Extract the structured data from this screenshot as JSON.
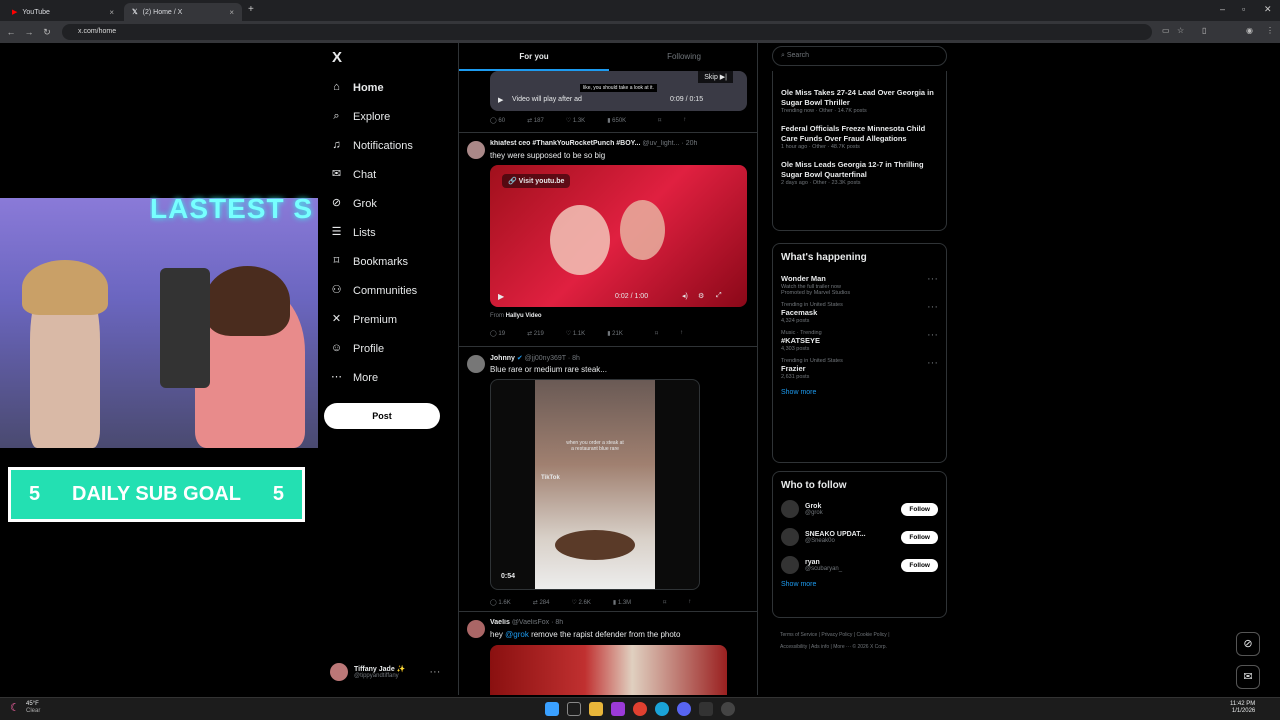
{
  "browser": {
    "tabs": [
      {
        "title": "YouTube",
        "active": false
      },
      {
        "title": "(2) Home / X",
        "active": true
      }
    ],
    "new_tab": "+",
    "url": "x.com/home"
  },
  "stream": {
    "banner": "LASTEST S",
    "goal_left": "5",
    "goal_label": "DAILY SUB GOAL",
    "goal_right": "5"
  },
  "sidebar": {
    "logo": "X",
    "items": [
      {
        "label": "Home",
        "icon": "home-icon"
      },
      {
        "label": "Explore",
        "icon": "search-icon"
      },
      {
        "label": "Notifications",
        "icon": "bell-icon"
      },
      {
        "label": "Chat",
        "icon": "mail-icon"
      },
      {
        "label": "Grok",
        "icon": "grok-icon"
      },
      {
        "label": "Lists",
        "icon": "list-icon"
      },
      {
        "label": "Bookmarks",
        "icon": "bookmark-icon"
      },
      {
        "label": "Communities",
        "icon": "people-icon"
      },
      {
        "label": "Premium",
        "icon": "x-icon"
      },
      {
        "label": "Profile",
        "icon": "person-icon"
      },
      {
        "label": "More",
        "icon": "more-icon"
      }
    ],
    "post_label": "Post",
    "user": {
      "name": "Tiffany Jade ✨",
      "handle": "@tippyandtiffany"
    }
  },
  "feed": {
    "tabs": [
      "For you",
      "Following"
    ],
    "ad": {
      "skip": "Skip",
      "caption": "like, you should take a look at it.",
      "play_text": "Video will play after ad",
      "time": "0:09 / 0:15",
      "stats": [
        "60",
        "187",
        "1.3K",
        "650K"
      ]
    },
    "tweet1": {
      "name": "khiafest ceo #ThankYouRocketPunch #BOY...",
      "handle": "@uv_light...",
      "time": "20h",
      "text": "they were supposed to be so big",
      "link": "Visit youtu.be",
      "video_time": "0:02 / 1:00",
      "from_prefix": "From",
      "from": "Hallyu Video",
      "stats": [
        "19",
        "219",
        "1.1K",
        "21K"
      ]
    },
    "tweet2": {
      "name": "Johnny",
      "handle": "@jj00ny369T",
      "time": "8h",
      "text": "Blue rare or medium rare steak...",
      "caption": "when you order a steak at a restaurant blue rare",
      "brand": "TikTok",
      "duration": "0:54",
      "stats": [
        "1.6K",
        "284",
        "2.6K",
        "1.3M"
      ]
    },
    "tweet3": {
      "name": "Vaelis",
      "handle": "@VaelisFox",
      "time": "8h",
      "text_prefix": "hey",
      "mention": "@grok",
      "text": "remove the rapist defender from the photo"
    }
  },
  "right": {
    "search_placeholder": "Search",
    "news": [
      {
        "title": "Ole Miss Takes 27-24 Lead Over Georgia in Sugar Bowl Thriller",
        "meta": "Trending now · Other · 14.7K posts"
      },
      {
        "title": "Federal Officials Freeze Minnesota Child Care Funds Over Fraud Allegations",
        "meta": "1 hour ago · Other · 48.7K posts"
      },
      {
        "title": "Ole Miss Leads Georgia 12-7 in Thrilling Sugar Bowl Quarterfinal",
        "meta": "2 days ago · Other · 23.3K posts"
      }
    ],
    "happening_title": "What's happening",
    "happening": [
      {
        "context": "",
        "title": "Wonder Man",
        "sub": "Watch the full trailer now",
        "posts": "Promoted by Marvel Studios"
      },
      {
        "context": "Trending in United States",
        "title": "Facemask",
        "sub": "",
        "posts": "4,324 posts"
      },
      {
        "context": "Music · Trending",
        "title": "#KATSEYE",
        "sub": "",
        "posts": "4,303 posts"
      },
      {
        "context": "Trending in United States",
        "title": "Frazier",
        "sub": "",
        "posts": "2,631 posts"
      }
    ],
    "show_more": "Show more",
    "wtf_title": "Who to follow",
    "wtf": [
      {
        "name": "Grok",
        "handle": "@grok"
      },
      {
        "name": "SNEAKO UPDAT...",
        "handle": "@Sneak0o"
      },
      {
        "name": "ryan",
        "handle": "@scubaryan_"
      }
    ],
    "follow_label": "Follow",
    "footer": [
      "Terms of Service",
      "Privacy Policy",
      "Cookie Policy",
      "Accessibility",
      "Ads info",
      "More ···",
      "© 2026 X Corp."
    ]
  },
  "taskbar": {
    "weather_temp": "45°F",
    "weather_cond": "Clear",
    "time": "11:42 PM",
    "date": "1/1/2026"
  }
}
